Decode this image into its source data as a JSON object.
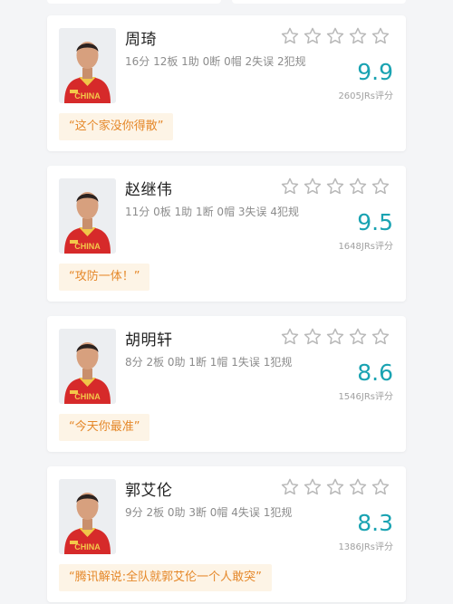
{
  "accent_color": "#1aa3b2",
  "quote_color": "#e5882a",
  "players": [
    {
      "name": "周琦",
      "stats": "16分 12板 1助 0断 0帽 2失误 2犯规",
      "score": "9.9",
      "raters": "2605JRs评分",
      "quote": "“这个家没你得散”",
      "avatar_icon": "player-photo",
      "jersey_text": "CHINA",
      "stars_filled": 0
    },
    {
      "name": "赵继伟",
      "stats": "11分 0板 1助 1断 0帽 3失误 4犯规",
      "score": "9.5",
      "raters": "1648JRs评分",
      "quote": "“攻防一体！”",
      "avatar_icon": "player-photo",
      "jersey_text": "CHINA",
      "stars_filled": 0
    },
    {
      "name": "胡明轩",
      "stats": "8分 2板 0助 1断 1帽 1失误 1犯规",
      "score": "8.6",
      "raters": "1546JRs评分",
      "quote": "“今天你最准”",
      "avatar_icon": "player-photo",
      "jersey_text": "CHINA",
      "stars_filled": 0
    },
    {
      "name": "郭艾伦",
      "stats": "9分 2板 0助 3断 0帽 4失误 1犯规",
      "score": "8.3",
      "raters": "1386JRs评分",
      "quote": "“腾讯解说:全队就郭艾伦一个人敢突”",
      "avatar_icon": "player-photo",
      "jersey_text": "CHINA",
      "stars_filled": 0
    }
  ]
}
